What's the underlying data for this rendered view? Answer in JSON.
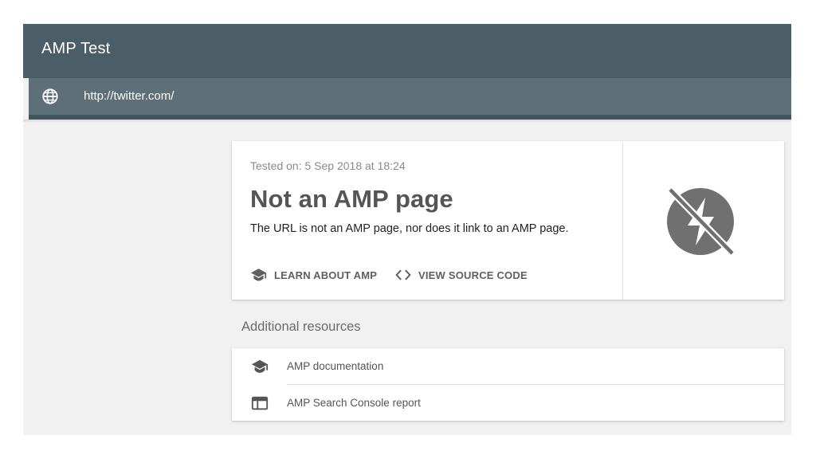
{
  "app": {
    "title": "AMP Test"
  },
  "url_bar": {
    "icon": "globe-icon",
    "url": "http://twitter.com/"
  },
  "result": {
    "tested_on": "Tested on: 5 Sep 2018 at 18:24",
    "title": "Not an AMP page",
    "description": "The URL is not an AMP page, nor does it link to an AMP page.",
    "status_icon": "amp-bolt-crossed-icon",
    "actions": [
      {
        "label": "LEARN ABOUT AMP",
        "icon": "school-icon"
      },
      {
        "label": "VIEW SOURCE CODE",
        "icon": "code-icon"
      }
    ]
  },
  "resources": {
    "heading": "Additional resources",
    "items": [
      {
        "label": "AMP documentation",
        "icon": "school-icon"
      },
      {
        "label": "AMP Search Console report",
        "icon": "web-report-icon"
      }
    ]
  },
  "colors": {
    "app_bar": "#4b5d67",
    "url_bar": "#5f6f78",
    "background": "#f1f1f1",
    "status_icon": "#707070"
  }
}
